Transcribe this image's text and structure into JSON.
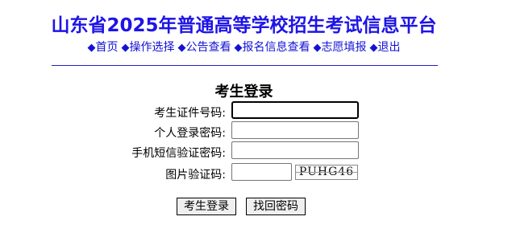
{
  "header": {
    "title": "山东省2025年普通高等学校招生考试信息平台"
  },
  "nav": {
    "items": [
      {
        "label": "首页"
      },
      {
        "label": "操作选择"
      },
      {
        "label": "公告查看"
      },
      {
        "label": "报名信息查看"
      },
      {
        "label": "志愿填报"
      },
      {
        "label": "退出"
      }
    ],
    "bullet": "◆"
  },
  "login": {
    "title": "考生登录",
    "fields": {
      "id_label": "考生证件号码:",
      "id_value": "",
      "password_label": "个人登录密码:",
      "password_value": "",
      "sms_label": "手机短信验证密码:",
      "sms_value": "",
      "captcha_label": "图片验证码:",
      "captcha_value": ""
    },
    "captcha_text": "PUHG46",
    "login_button": "考生登录",
    "recover_button": "找回密码"
  }
}
